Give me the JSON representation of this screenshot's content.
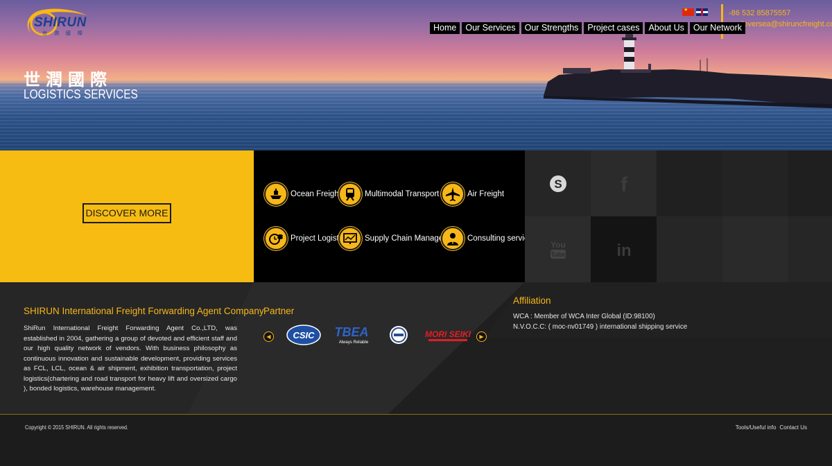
{
  "logo": {
    "name": "SHIRUN",
    "sub": "世 潤 國 際"
  },
  "hero": {
    "title_cn": "世潤國際",
    "subtitle": "LOGISTICS SERVICES"
  },
  "languages": [
    "Chinese",
    "English"
  ],
  "contact": {
    "phone": "-86 532 85875557",
    "email": "srqdoversea@shiruncfreight.com"
  },
  "nav": {
    "items": [
      "Home",
      "Our Services",
      "Our Strengths",
      "Project cases",
      "About Us",
      "Our Network"
    ]
  },
  "cta": {
    "discover_label": "DISCOVER MORE"
  },
  "services": [
    {
      "label": "Ocean Freight",
      "icon": "ship-icon"
    },
    {
      "label": "Multimodal Transport",
      "icon": "train-icon"
    },
    {
      "label": "Air Freight",
      "icon": "airplane-icon"
    },
    {
      "label": "Project Logistics",
      "icon": "clock-coins-icon"
    },
    {
      "label": "Supply Chain Management",
      "icon": "monitor-chart-icon"
    },
    {
      "label": "Consulting services",
      "icon": "person-icon"
    }
  ],
  "social": [
    "skype-icon",
    "facebook-icon",
    "youtube-icon",
    "linkedin-icon"
  ],
  "company": {
    "title": "SHIRUN International Freight Forwarding Agent Company",
    "body": "ShiRun International Freight Forwarding Agent Co.,LTD, was established in 2004, gathering a group of devoted and efficient staff and our high quality network of vendors. With business philosophy as continuous innovation and sustainable development, providing services as FCL, LCL, ocean & air shipment, exhibition transportation, project logistics(chartering and road transport for heavy lift and oversized cargo ), bonded logistics, warehouse management."
  },
  "partner": {
    "title": "Partner",
    "logos": [
      "CSIC",
      "TBEA",
      "Always Reliable",
      "MORI SEIKI"
    ]
  },
  "affiliation": {
    "title": "Affiliation",
    "lines": [
      "WCA : Member of WCA Inter Global (ID:98100)",
      "N.V.O.C.C: ( moc-nv01749 ) international shipping service"
    ]
  },
  "footer": {
    "copyright": "Copyright © 2015 SHIRUN. All rights reserved.",
    "links": [
      "Tools/Useful info",
      "Contact Us"
    ]
  },
  "colors": {
    "accent": "#f7b718",
    "dark": "#000000",
    "panel": "#232323"
  }
}
